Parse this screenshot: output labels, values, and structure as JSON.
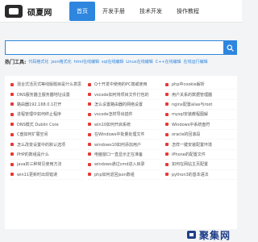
{
  "site": {
    "logo_text": "硕夏网",
    "logo_icon": "logo-mark"
  },
  "nav": {
    "items": [
      {
        "label": "首页",
        "active": true
      },
      {
        "label": "开发手册",
        "active": false
      },
      {
        "label": "技术开发",
        "active": false
      },
      {
        "label": "操作教程",
        "active": false
      }
    ]
  },
  "search": {
    "value": "",
    "placeholder": "",
    "button_icon": "search-icon"
  },
  "hot_tools": {
    "label": "热门工具:",
    "links": [
      "代码格式化",
      "json格式化",
      "html在线编辑",
      "sql在线编辑",
      "Linux在线编辑",
      "C++在线编辑",
      "在线运行编辑"
    ]
  },
  "articles": [
    "混合式活页式等线版题目是什么意思",
    "Q十开发中使用的PC端或使用",
    "php中cookie解析",
    "DNS服务器主服务器地址设置",
    "vscode如何将项目文件打包的",
    "用户关系的数据管理器",
    "路由器192.168.0.1打开",
    "怎么设置路由器的网络设置",
    "nginx配置alias与root",
    "进程管理中如何终止程序",
    "vscode怎样导出插件",
    "mysql安装教程图解",
    "DNS模式 Dublin Core",
    "win10如何开启系统",
    "Windows中系统盘符",
    "C盘如何扩展空间",
    "在Windows中批量处理文件",
    "oracle的回滚段",
    "怎么改变设置中的默认选项",
    "windows10如何添加用户",
    "怎样一键安装配置环境",
    "PHP的数组是什么",
    "电脑窗口一直显示正在准备",
    "iPhone的配置文件",
    "java的三种常见使用方法",
    "windows通过cmd进入目录",
    "如何在网站主页配置",
    "win11更新时出现错误",
    "php如何返回json数组",
    "python3的基本语法"
  ],
  "watermark": {
    "icon": "watermark-logo-icon",
    "text": "聚集网"
  }
}
